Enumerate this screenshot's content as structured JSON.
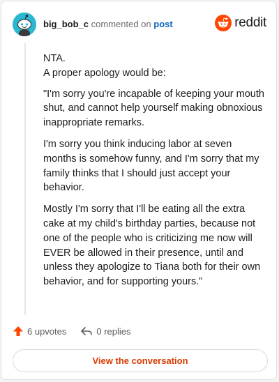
{
  "header": {
    "username": "big_bob_c",
    "commented_text": "commented on",
    "post_link": "post",
    "logo_text": "reddit",
    "avatar_icon": "snoo-avatar-icon",
    "logo_icon": "reddit-snoo-logo-icon"
  },
  "comment": {
    "paragraphs": [
      "NTA.\nA proper apology would be:",
      "\"I'm sorry you're incapable of keeping your mouth shut, and cannot help yourself making obnoxious inappropriate remarks.",
      "I'm sorry you think inducing labor at seven months is somehow funny, and I'm sorry that my family thinks that I should just accept your behavior.",
      "Mostly I'm sorry that I'll be eating all the extra cake at my child's birthday parties, because not one of the people who is criticizing me now will EVER be allowed in their presence, until and unless they apologize to Tiana both for their own behavior, and for supporting yours.\""
    ]
  },
  "actions": {
    "upvotes": "6 upvotes",
    "replies": "0 replies",
    "upvote_icon": "upvote-arrow-icon",
    "reply_icon": "reply-arrow-icon"
  },
  "button": {
    "label": "View the conversation"
  },
  "colors": {
    "brand": "#ff4500",
    "link": "#0b66c2",
    "button_text": "#d93a00",
    "avatar_bg": "#2ab7cf"
  }
}
